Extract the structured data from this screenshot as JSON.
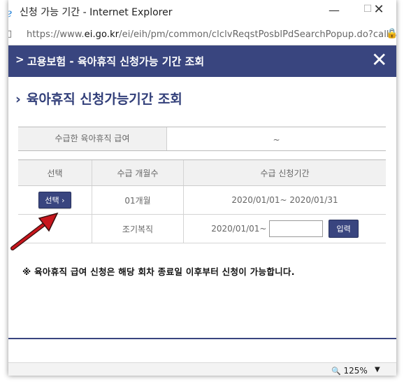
{
  "window": {
    "title": "신청 가능 기간 - Internet Explorer",
    "min_glyph": "—",
    "max_glyph": "☐",
    "close_glyph": "✕"
  },
  "address": {
    "protocol": "https://www.",
    "domain": "ei.go.kr",
    "path": "/ei/eih/pm/common/clclvReqstPosblPdSearchPopup.do?callBac"
  },
  "popup": {
    "header_chevron": ">",
    "header_title": "고용보험 - 육아휴직 신청가능 기간 조회",
    "close_glyph": "✕"
  },
  "heading": {
    "chevron": "›",
    "text": "육아휴직 신청가능기간 조회"
  },
  "summary": {
    "label": "수급한 육아휴직 급여",
    "value": "~"
  },
  "table": {
    "headers": [
      "선택",
      "수급 개월수",
      "수급 신청기간"
    ],
    "row1": {
      "button_label": "선택 ›",
      "months": "01개월",
      "period": "2020/01/01~ 2020/01/31"
    },
    "row2": {
      "months": "조기복직",
      "period_start": "2020/01/01~",
      "date_value": "",
      "input_button": "입력"
    }
  },
  "notice": "※ 육아휴직 급여 신청은 해당 회차 종료일 이후부터 신청이 가능합니다.",
  "statusbar": {
    "zoom_icon": "🔍",
    "zoom": "125%",
    "zoom_dropdown": "▼"
  },
  "colors": {
    "header_bg": "#39457f",
    "annotation_arrow": "#c8161d"
  }
}
